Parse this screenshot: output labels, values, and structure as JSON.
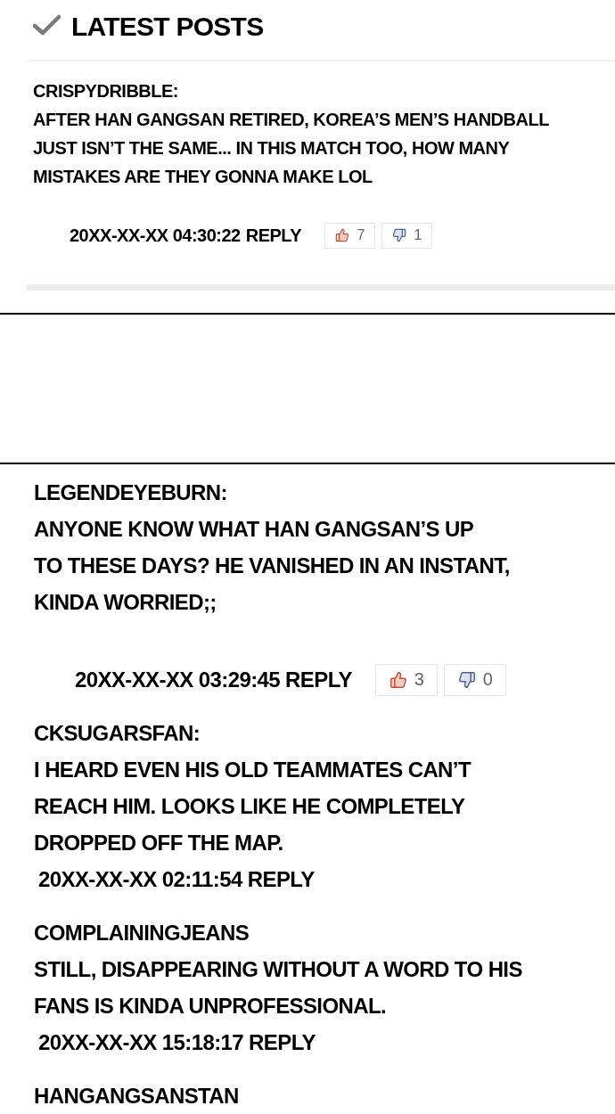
{
  "header": {
    "title": "LATEST POSTS"
  },
  "panels": [
    {
      "kind": "card",
      "comments": [
        {
          "username": "CRISPYDRIBBLE:",
          "body_lines": [
            "AFTER HAN GANGSAN RETIRED, KOREA’S MEN’S HANDBALL",
            "JUST ISN’T THE SAME... IN THIS MATCH TOO, HOW MANY",
            "MISTAKES ARE THEY GONNA MAKE LOL"
          ],
          "timestamp": "20XX-XX-XX 04:30:22",
          "reply": "REPLY",
          "likes": "7",
          "dislikes": "1"
        }
      ]
    },
    {
      "kind": "plain",
      "comments": [
        {
          "username": "LEGENDEYEBURN:",
          "body_lines": [
            "ANYONE KNOW WHAT HAN GANGSAN’S UP",
            "TO THESE DAYS? HE VANISHED IN AN INSTANT,",
            "KINDA WORRIED;;"
          ],
          "timestamp": "20XX-XX-XX 03:29:45",
          "reply": "REPLY",
          "likes": "3",
          "dislikes": "0"
        },
        {
          "username": "CKSUGARSFAN:",
          "body_lines": [
            "I HEARD EVEN HIS OLD TEAMMATES CAN’T",
            "REACH HIM. LOOKS LIKE HE COMPLETELY",
            "DROPPED OFF THE MAP."
          ],
          "timestamp": "20XX-XX-XX 02:11:54",
          "reply": "REPLY"
        },
        {
          "username": "COMPLAININGJEANS",
          "body_lines": [
            "STILL, DISAPPEARING WITHOUT A WORD TO HIS",
            "FANS IS KINDA UNPROFESSIONAL."
          ],
          "timestamp": "20XX-XX-XX 15:18:17",
          "reply": "REPLY"
        },
        {
          "username": "HANGANGSANSTAN"
        }
      ]
    }
  ]
}
